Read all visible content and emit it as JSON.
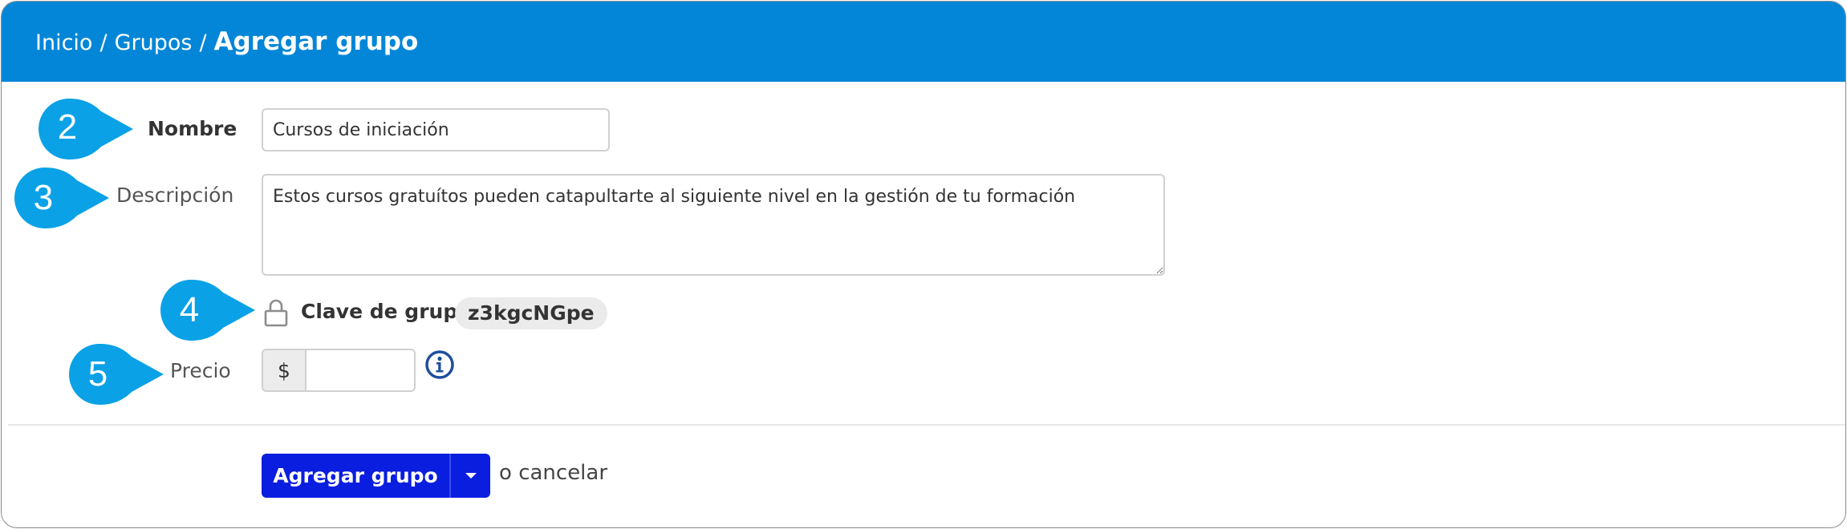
{
  "breadcrumb": {
    "home": "Inicio",
    "groups": "Grupos",
    "separator": "/",
    "current": "Agregar grupo"
  },
  "callouts": [
    "2",
    "3",
    "4",
    "5"
  ],
  "form": {
    "name_label": "Nombre",
    "name_value": "Cursos de iniciación",
    "description_label": "Descripción",
    "description_value": "Estos cursos gratuítos pueden catapultarte al siguiente nivel en la gestión de tu formación",
    "group_key_label": "Clave de grupo",
    "group_key_value": "z3kgcNGpe",
    "price_label": "Precio",
    "currency_symbol": "$",
    "price_value": ""
  },
  "actions": {
    "submit_label": "Agregar grupo",
    "or_text": "o",
    "cancel_label": "cancelar"
  },
  "icons": {
    "lock": "lock-icon",
    "info": "info-icon",
    "dropdown": "caret-down-icon"
  },
  "colors": {
    "header": "#0386d7",
    "callout": "#0aa1e6",
    "primary_button": "#0a1ee0",
    "info_icon": "#1f4e9c"
  }
}
